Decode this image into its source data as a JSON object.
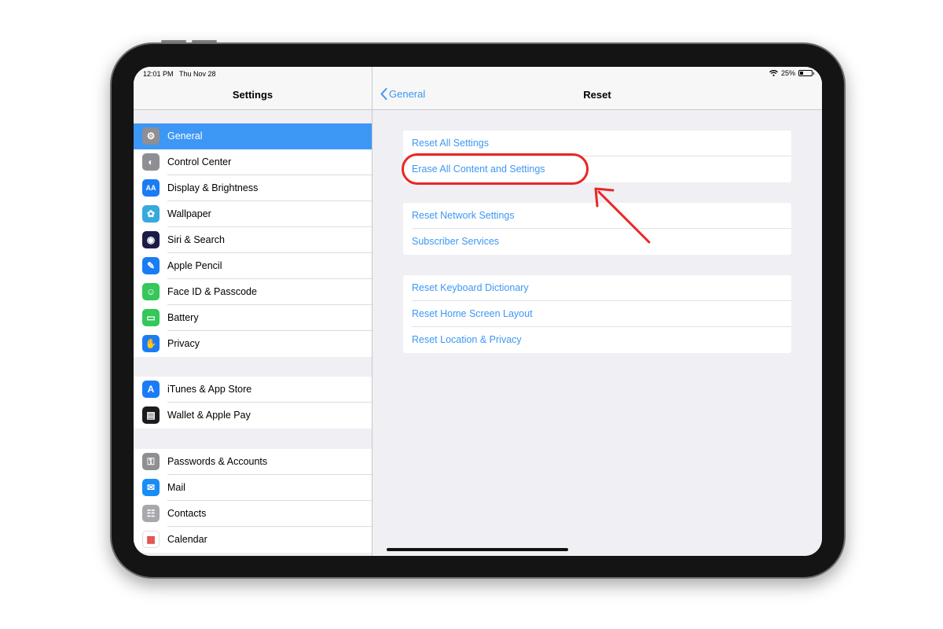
{
  "status_bar": {
    "time": "12:01 PM",
    "date": "Thu Nov 28",
    "battery": "25%",
    "battery_level": 0.25
  },
  "master": {
    "title": "Settings",
    "groups": [
      [
        {
          "label": "General",
          "icon": "gear-icon",
          "color": "#8e8e93",
          "selected": true
        },
        {
          "label": "Control Center",
          "icon": "switches-icon",
          "color": "#8e8e93"
        },
        {
          "label": "Display & Brightness",
          "icon": "text-size-icon",
          "color": "#1a7cf5"
        },
        {
          "label": "Wallpaper",
          "icon": "flower-icon",
          "color": "#36aadc"
        },
        {
          "label": "Siri & Search",
          "icon": "siri-icon",
          "color": "#1c1c4a"
        },
        {
          "label": "Apple Pencil",
          "icon": "pencil-icon",
          "color": "#1a7cf5"
        },
        {
          "label": "Face ID & Passcode",
          "icon": "face-id-icon",
          "color": "#34c759"
        },
        {
          "label": "Battery",
          "icon": "battery-icon",
          "color": "#34c759"
        },
        {
          "label": "Privacy",
          "icon": "hand-icon",
          "color": "#1a7cf5"
        }
      ],
      [
        {
          "label": "iTunes & App Store",
          "icon": "app-store-icon",
          "color": "#1a7cf5"
        },
        {
          "label": "Wallet & Apple Pay",
          "icon": "wallet-icon",
          "color": "#1c1c1e"
        }
      ],
      [
        {
          "label": "Passwords & Accounts",
          "icon": "key-icon",
          "color": "#8e8e93"
        },
        {
          "label": "Mail",
          "icon": "mail-icon",
          "color": "#1a8df5"
        },
        {
          "label": "Contacts",
          "icon": "contacts-icon",
          "color": "#a8a8ac"
        },
        {
          "label": "Calendar",
          "icon": "calendar-icon",
          "color": "#ffffff"
        }
      ]
    ]
  },
  "detail": {
    "back_label": "General",
    "title": "Reset",
    "sections": [
      [
        "Reset All Settings",
        "Erase All Content and Settings"
      ],
      [
        "Reset Network Settings",
        "Subscriber Services"
      ],
      [
        "Reset Keyboard Dictionary",
        "Reset Home Screen Layout",
        "Reset Location & Privacy"
      ]
    ]
  },
  "colors": {
    "accent": "#3d97f4",
    "annotation": "#ea2626"
  }
}
